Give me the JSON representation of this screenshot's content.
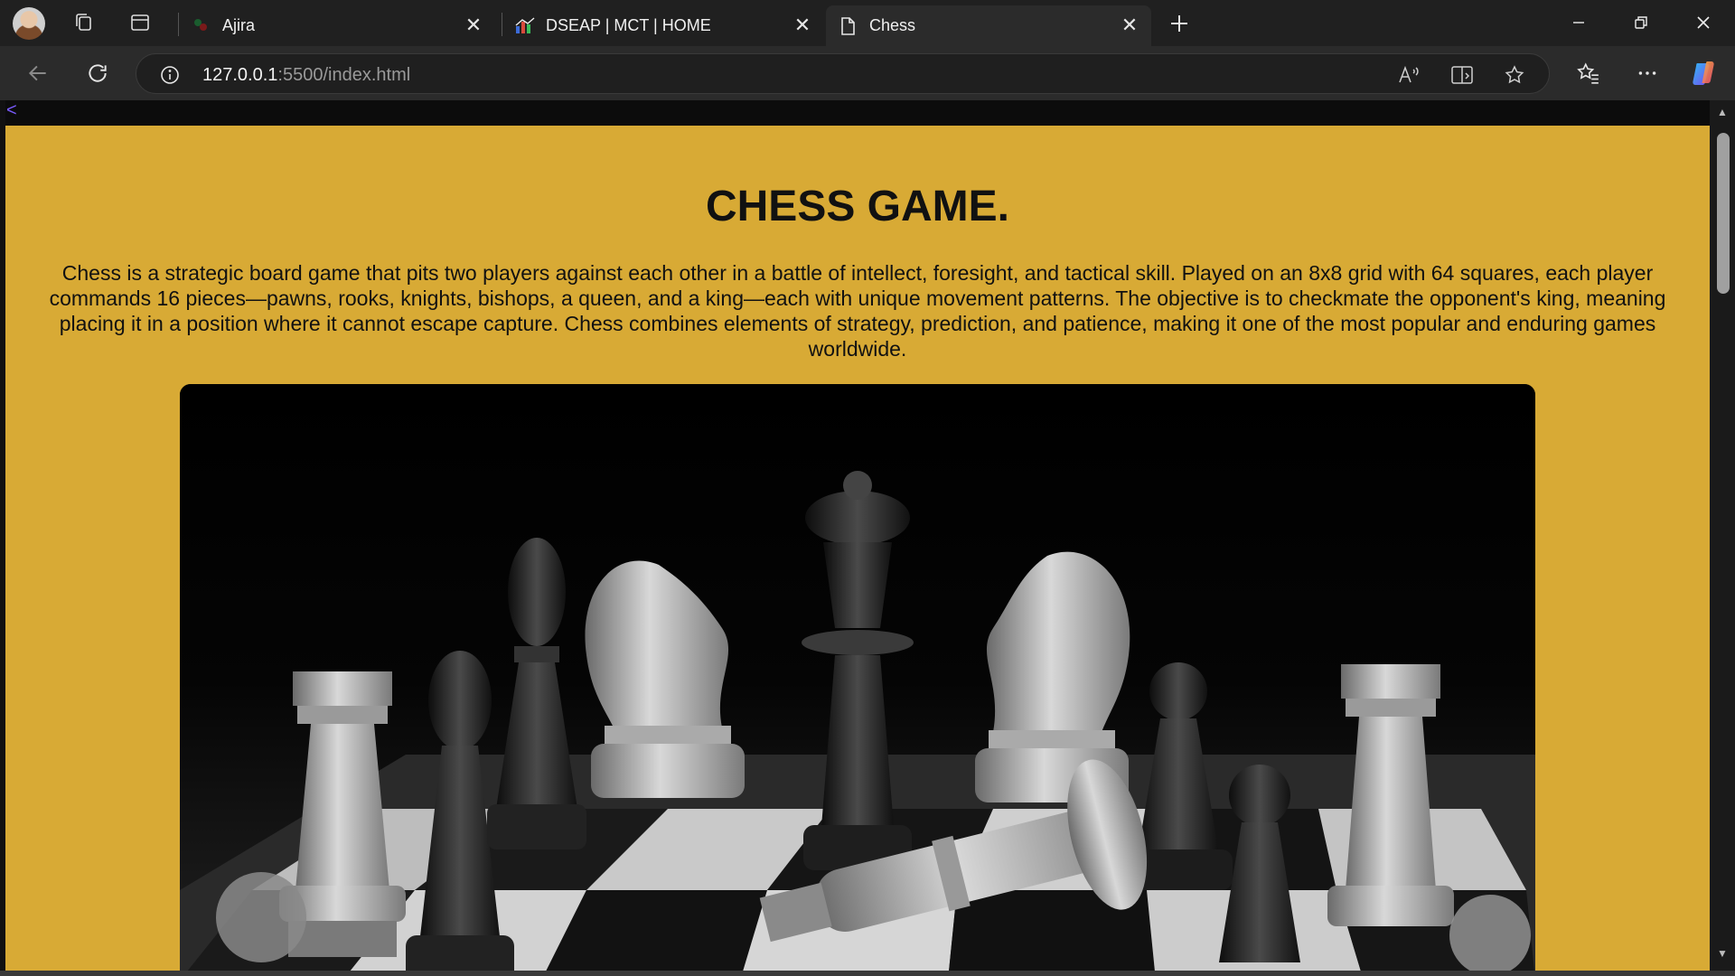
{
  "browser": {
    "tabs": [
      {
        "title": "Ajira",
        "favicon": "ajira-icon"
      },
      {
        "title": "DSEAP | MCT | HOME",
        "favicon": "dseap-icon"
      },
      {
        "title": "Chess",
        "favicon": "page-icon",
        "active": true
      }
    ],
    "address": {
      "host": "127.0.0.1",
      "rest": ":5500/index.html"
    }
  },
  "page": {
    "back_link": "<",
    "title": "CHESS GAME.",
    "description": "Chess is a strategic board game that pits two players against each other in a battle of intellect, foresight, and tactical skill. Played on an 8x8 grid with 64 squares, each player commands 16 pieces—pawns, rooks, knights, bishops, a queen, and a king—each with unique movement patterns. The objective is to checkmate the opponent's king, meaning placing it in a position where it cannot escape capture. Chess combines elements of strategy, prediction, and patience, making it one of the most popular and enduring games worldwide.",
    "background_color": "#D8AA35",
    "hero_image": "chess-pieces-photo"
  }
}
